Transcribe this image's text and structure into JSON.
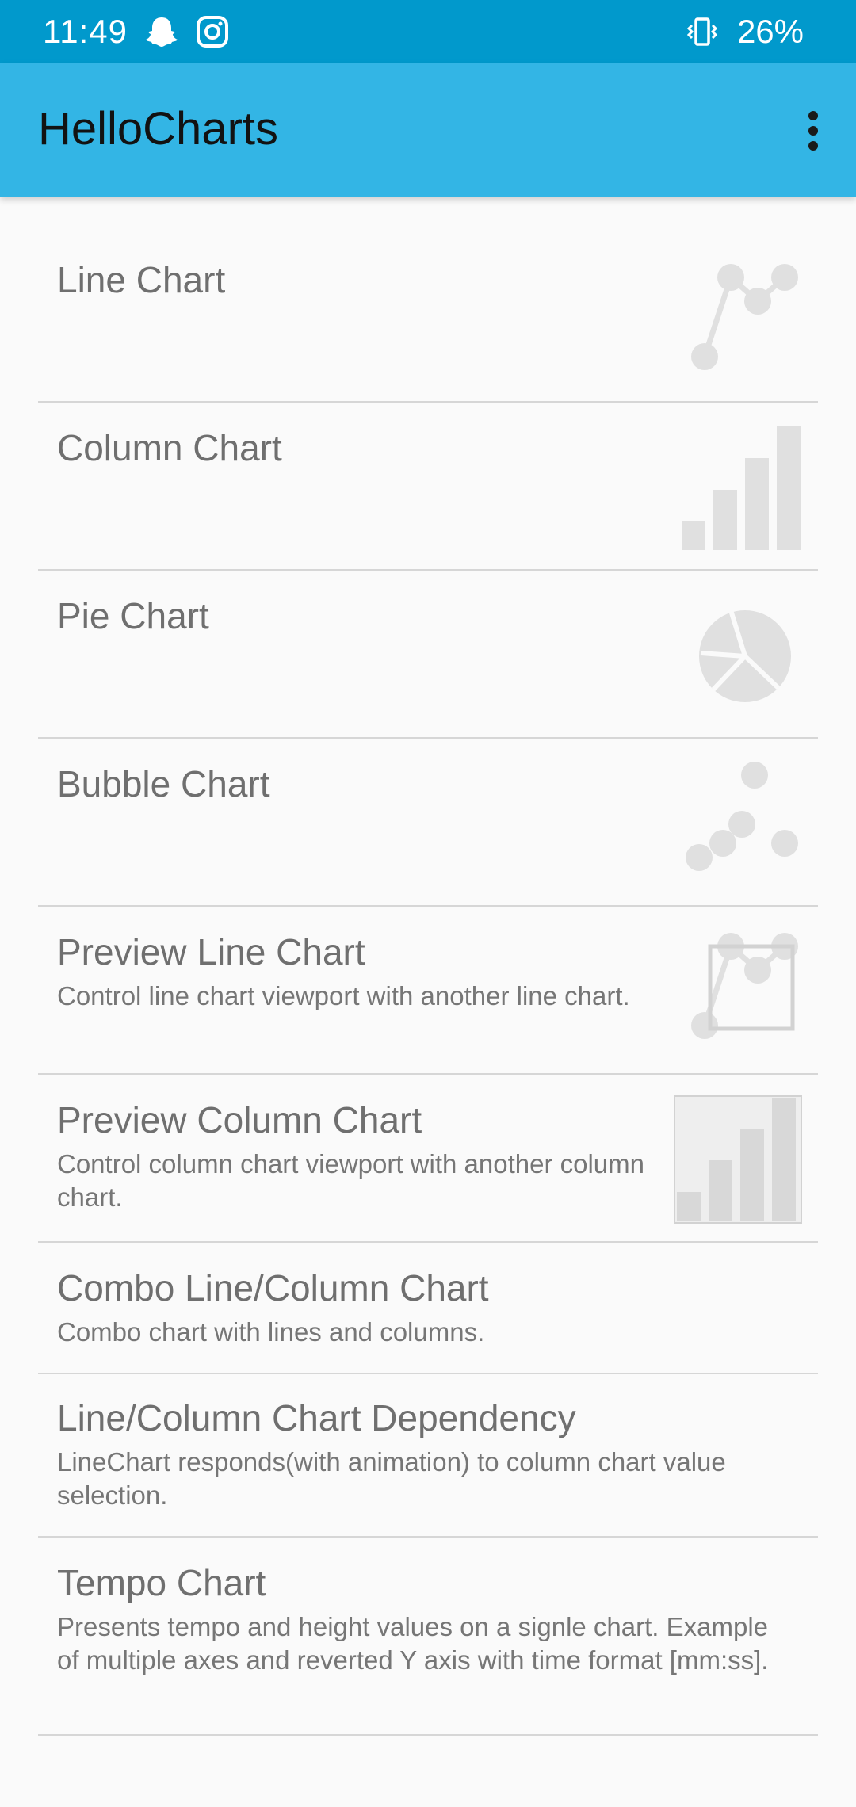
{
  "status_bar": {
    "time": "11:49",
    "left_icons": [
      "snapchat-icon",
      "instagram-icon"
    ],
    "right_icons": [
      "vibrate-icon"
    ],
    "battery": "26%",
    "background": "#0199cc"
  },
  "app_bar": {
    "title": "HelloCharts",
    "menu_icon": "overflow-menu-icon",
    "background": "#33b5e5"
  },
  "items": [
    {
      "title": "Line Chart",
      "subtitle": "",
      "icon": "line-chart-icon"
    },
    {
      "title": "Column Chart",
      "subtitle": "",
      "icon": "column-chart-icon"
    },
    {
      "title": "Pie Chart",
      "subtitle": "",
      "icon": "pie-chart-icon"
    },
    {
      "title": "Bubble Chart",
      "subtitle": "",
      "icon": "bubble-chart-icon"
    },
    {
      "title": "Preview Line Chart",
      "subtitle": "Control line chart viewport with another line chart.",
      "icon": "preview-line-chart-icon"
    },
    {
      "title": "Preview Column Chart",
      "subtitle": "Control column chart viewport with another column chart.",
      "icon": "preview-column-chart-icon"
    },
    {
      "title": "Combo Line/Column Chart",
      "subtitle": "Combo chart with lines and columns.",
      "icon": ""
    },
    {
      "title": "Line/Column Chart Dependency",
      "subtitle": "LineChart responds(with animation) to column chart value selection.",
      "icon": ""
    },
    {
      "title": "Tempo Chart",
      "subtitle": "Presents tempo and height values on a signle chart. Example of multiple axes and reverted Y axis with time format [mm:ss].",
      "icon": ""
    }
  ]
}
